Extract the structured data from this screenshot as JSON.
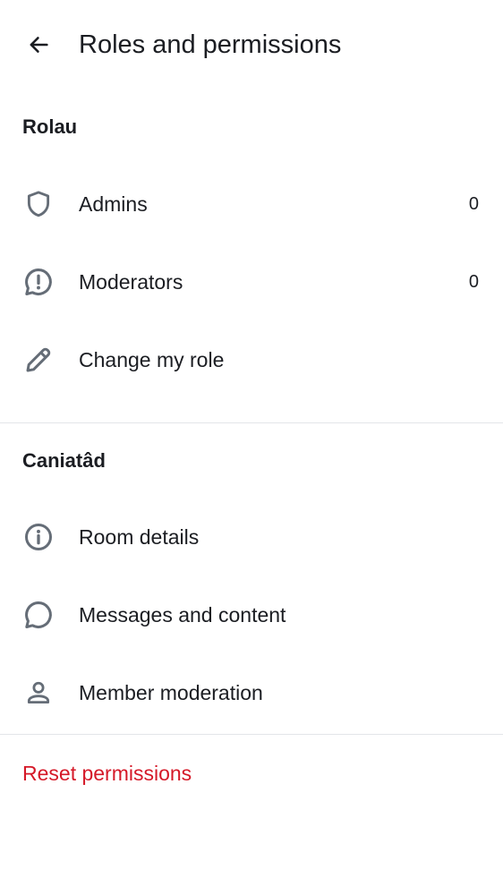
{
  "header": {
    "title": "Roles and permissions",
    "back_icon": "arrow-left-icon"
  },
  "roles_section": {
    "title": "Rolau",
    "items": [
      {
        "label": "Admins",
        "count": "0",
        "icon": "shield-icon"
      },
      {
        "label": "Moderators",
        "count": "0",
        "icon": "chat-alert-icon"
      },
      {
        "label": "Change my role",
        "icon": "pencil-icon"
      }
    ]
  },
  "permissions_section": {
    "title": "Caniatâd",
    "items": [
      {
        "label": "Room details",
        "icon": "info-icon"
      },
      {
        "label": "Messages and content",
        "icon": "chat-bubble-icon"
      },
      {
        "label": "Member moderation",
        "icon": "user-icon"
      }
    ]
  },
  "reset": {
    "label": "Reset permissions"
  },
  "colors": {
    "text": "#1b1d22",
    "icon": "#656d77",
    "divider": "#e3e5e9",
    "critical": "#d51928",
    "background": "#ffffff"
  }
}
